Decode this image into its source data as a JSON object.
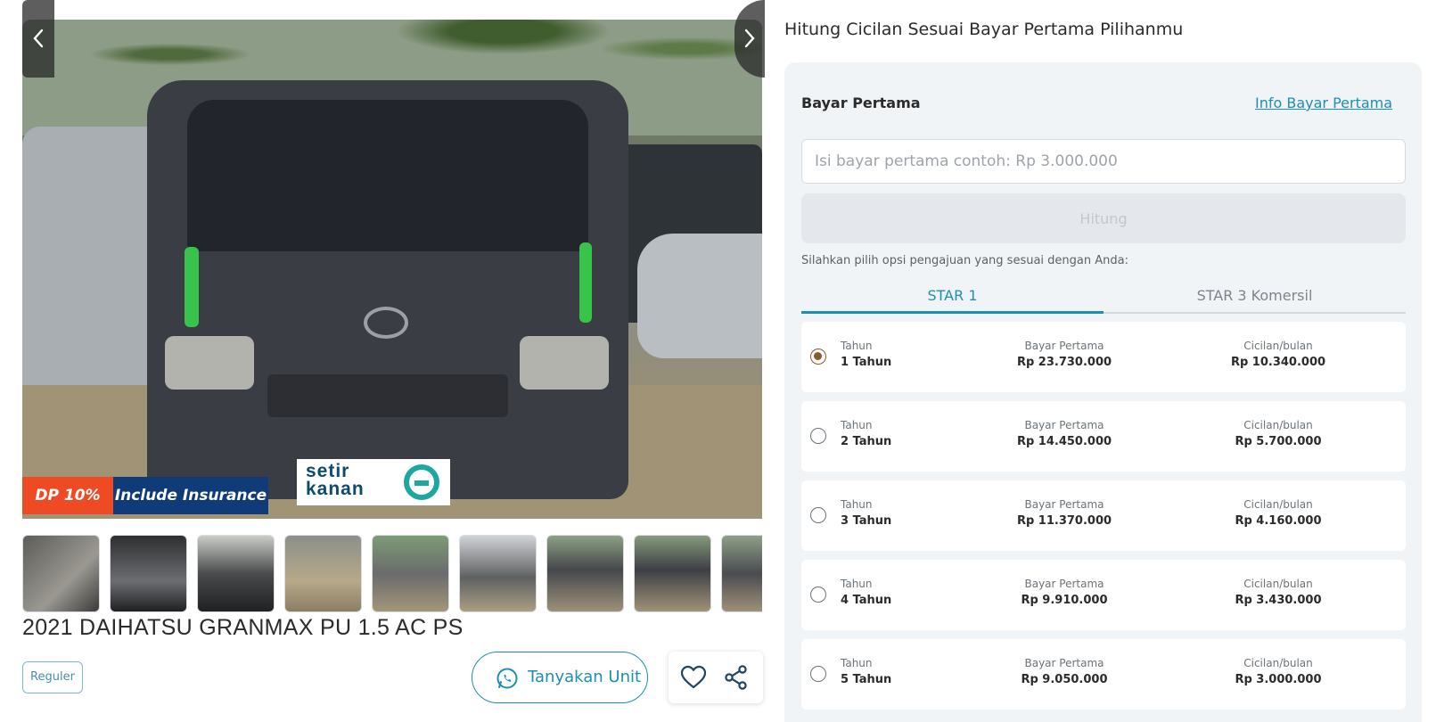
{
  "listing": {
    "badge_dp": "DP 10%",
    "badge_insurance": "Include Insurance",
    "watermark": "setir kanan",
    "title": "2021 DAIHATSU GRANMAX PU 1.5 AC PS",
    "tag": "Reguler",
    "ask_button": "Tanyakan Unit",
    "thumbnails_count": 9,
    "icons": {
      "prev": "chevron-left-icon",
      "next": "chevron-right-icon",
      "whatsapp": "whatsapp-icon",
      "favorite": "heart-icon",
      "share": "share-icon"
    }
  },
  "calculator": {
    "heading": "Hitung Cicilan Sesuai Bayar Pertama Pilihanmu",
    "field_label": "Bayar Pertama",
    "info_link": "Info Bayar Pertama",
    "input_placeholder": "Isi bayar pertama contoh: Rp 3.000.000",
    "input_value": "",
    "calc_button": "Hitung",
    "hint": "Silahkan pilih opsi pengajuan yang sesuai dengan Anda:",
    "tabs": [
      {
        "label": "STAR 1",
        "active": true
      },
      {
        "label": "STAR 3 Komersil",
        "active": false
      }
    ],
    "options": [
      {
        "tenor_label": "Tahun",
        "tenor": "1 Tahun",
        "dp_label": "Bayar Pertama",
        "dp": "Rp 23.730.000",
        "inst_label": "Cicilan/bulan",
        "inst": "Rp 10.340.000",
        "selected": true
      },
      {
        "tenor_label": "Tahun",
        "tenor": "2 Tahun",
        "dp_label": "Bayar Pertama",
        "dp": "Rp 14.450.000",
        "inst_label": "Cicilan/bulan",
        "inst": "Rp 5.700.000",
        "selected": false
      },
      {
        "tenor_label": "Tahun",
        "tenor": "3 Tahun",
        "dp_label": "Bayar Pertama",
        "dp": "Rp 11.370.000",
        "inst_label": "Cicilan/bulan",
        "inst": "Rp 4.160.000",
        "selected": false
      },
      {
        "tenor_label": "Tahun",
        "tenor": "4 Tahun",
        "dp_label": "Bayar Pertama",
        "dp": "Rp 9.910.000",
        "inst_label": "Cicilan/bulan",
        "inst": "Rp 3.430.000",
        "selected": false
      },
      {
        "tenor_label": "Tahun",
        "tenor": "5 Tahun",
        "dp_label": "Bayar Pertama",
        "dp": "Rp 9.050.000",
        "inst_label": "Cicilan/bulan",
        "inst": "Rp 3.000.000",
        "selected": false
      }
    ]
  },
  "colors": {
    "accent": "#1b8fb5",
    "dp_badge": "#ee4b25",
    "insurance_badge": "#0f3b78",
    "panel_bg": "#f1f4f7",
    "radio_selected": "#8b5a2b"
  }
}
